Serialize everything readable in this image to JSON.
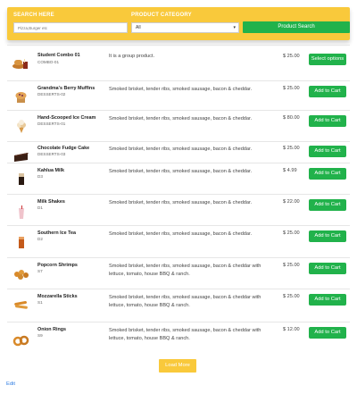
{
  "search": {
    "label": "SEARCH HERE",
    "placeholder": "Pizza,Burger etc",
    "category_label": "PRODUCT CATEGORY",
    "category_value": "All",
    "button_label": "Product Search"
  },
  "products": [
    {
      "name": "Student Combo 01",
      "code": "COMBO-01",
      "description": "It is a group product.",
      "price": "$ 25.00",
      "action": "Select options"
    },
    {
      "name": "Grandma's Berry Muffins",
      "code": "DESSERTS-02",
      "description": "Smoked brisket, tender ribs, smoked sausage, bacon & cheddar.",
      "price": "$ 25.00",
      "action": "Add to Cart"
    },
    {
      "name": "Hand-Scooped Ice Cream",
      "code": "DESSERTS-01",
      "description": "Smoked brisket, tender ribs, smoked sausage, bacon & cheddar.",
      "price": "$ 80.00",
      "action": "Add to Cart"
    },
    {
      "name": "Chocolate Fudge Cake",
      "code": "DESSERTS-03",
      "description": "Smoked brisket, tender ribs, smoked sausage, bacon & cheddar.",
      "price": "$ 25.00",
      "action": "Add to Cart"
    },
    {
      "name": "Kahlua Milk",
      "code": "D3",
      "description": "Smoked brisket, tender ribs, smoked sausage, bacon & cheddar.",
      "price": "$ 4.99",
      "action": "Add to Cart"
    },
    {
      "name": "Milk Shakes",
      "code": "D1",
      "description": "Smoked brisket, tender ribs, smoked sausage, bacon & cheddar.",
      "price": "$ 22.00",
      "action": "Add to Cart"
    },
    {
      "name": "Southern Ice Tea",
      "code": "D2",
      "description": "Smoked brisket, tender ribs, smoked sausage, bacon & cheddar.",
      "price": "$ 25.00",
      "action": "Add to Cart"
    },
    {
      "name": "Popcorn Shrimps",
      "code": "S7",
      "description": "Smoked brisket, tender ribs, smoked sausage, bacon & cheddar with lettuce, tomato, house BBQ & ranch.",
      "price": "$ 25.00",
      "action": "Add to Cart"
    },
    {
      "name": "Mozzarella Sticks",
      "code": "S1",
      "description": "Smoked brisket, tender ribs, smoked sausage, bacon & cheddar with lettuce, tomato, house BBQ & ranch.",
      "price": "$ 25.00",
      "action": "Add to Cart"
    },
    {
      "name": "Onion Rings",
      "code": "S9",
      "description": "Smoked brisket, tender ribs, smoked sausage, bacon & cheddar with lettuce, tomato, house BBQ & ranch.",
      "price": "$ 12.00",
      "action": "Add to Cart"
    }
  ],
  "load_more_label": "Load More",
  "edit_label": "Edit",
  "colors": {
    "accent_yellow": "#f9c93b",
    "button_green": "#21b24b",
    "link_blue": "#2a7ae2"
  }
}
